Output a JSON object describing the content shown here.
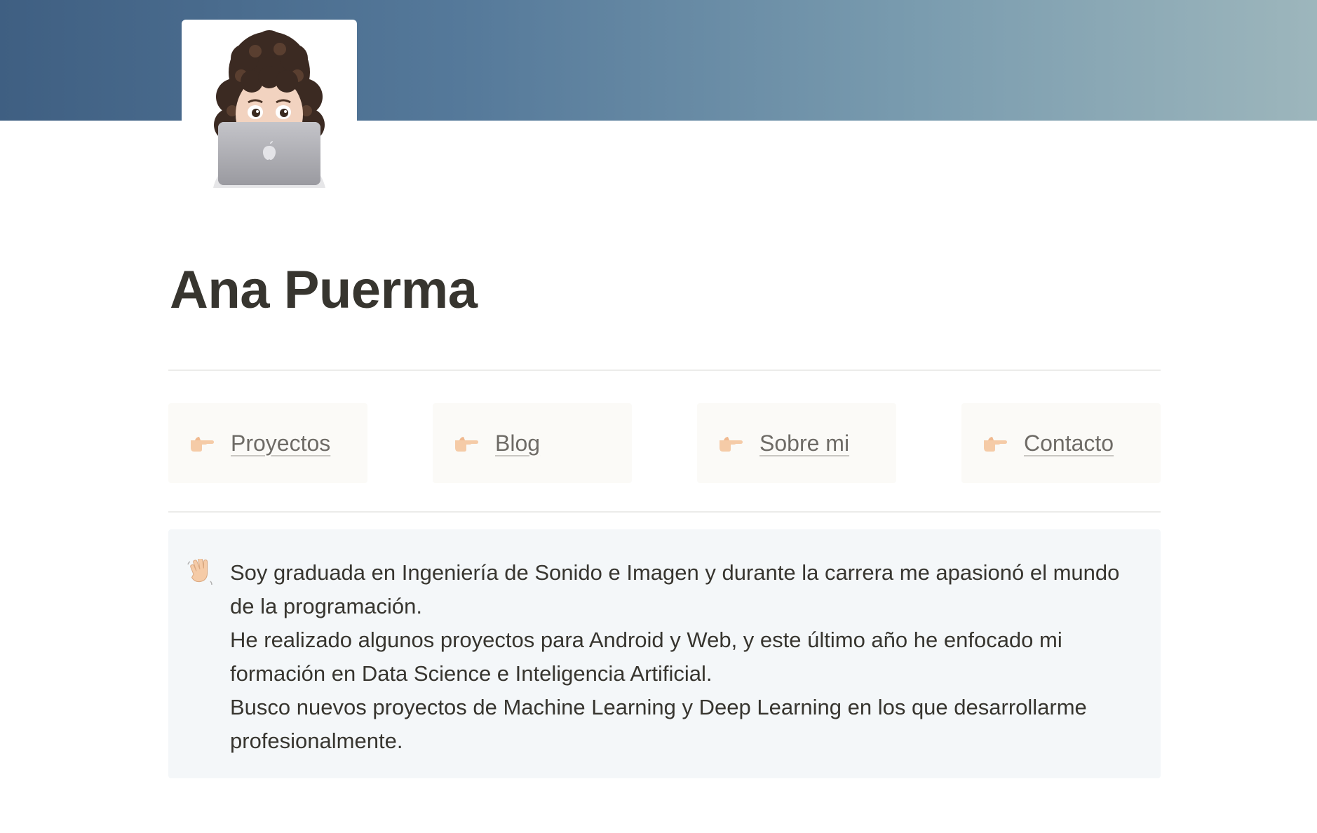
{
  "page": {
    "title": "Ana Puerma",
    "cover_colors": [
      "#3f5f82",
      "#9db6bc"
    ],
    "avatar": {
      "icon": "memoji-laptop-icon"
    }
  },
  "nav": {
    "icon": "pointing-hand-icon",
    "items": [
      {
        "label": "Proyectos"
      },
      {
        "label": "Blog"
      },
      {
        "label": "Sobre mi"
      },
      {
        "label": "Contacto"
      }
    ]
  },
  "callout": {
    "icon": "waving-hand-icon",
    "lines": [
      "Soy graduada en Ingeniería de Sonido e Imagen y durante la carrera me apasionó el mundo de la programación.",
      "He realizado algunos proyectos para Android y Web, y este último año he enfocado mi formación en Data Science e Inteligencia Artificial.",
      "Busco nuevos proyectos de Machine Learning y Deep Learning en los que desarrollarme profesionalmente."
    ]
  }
}
